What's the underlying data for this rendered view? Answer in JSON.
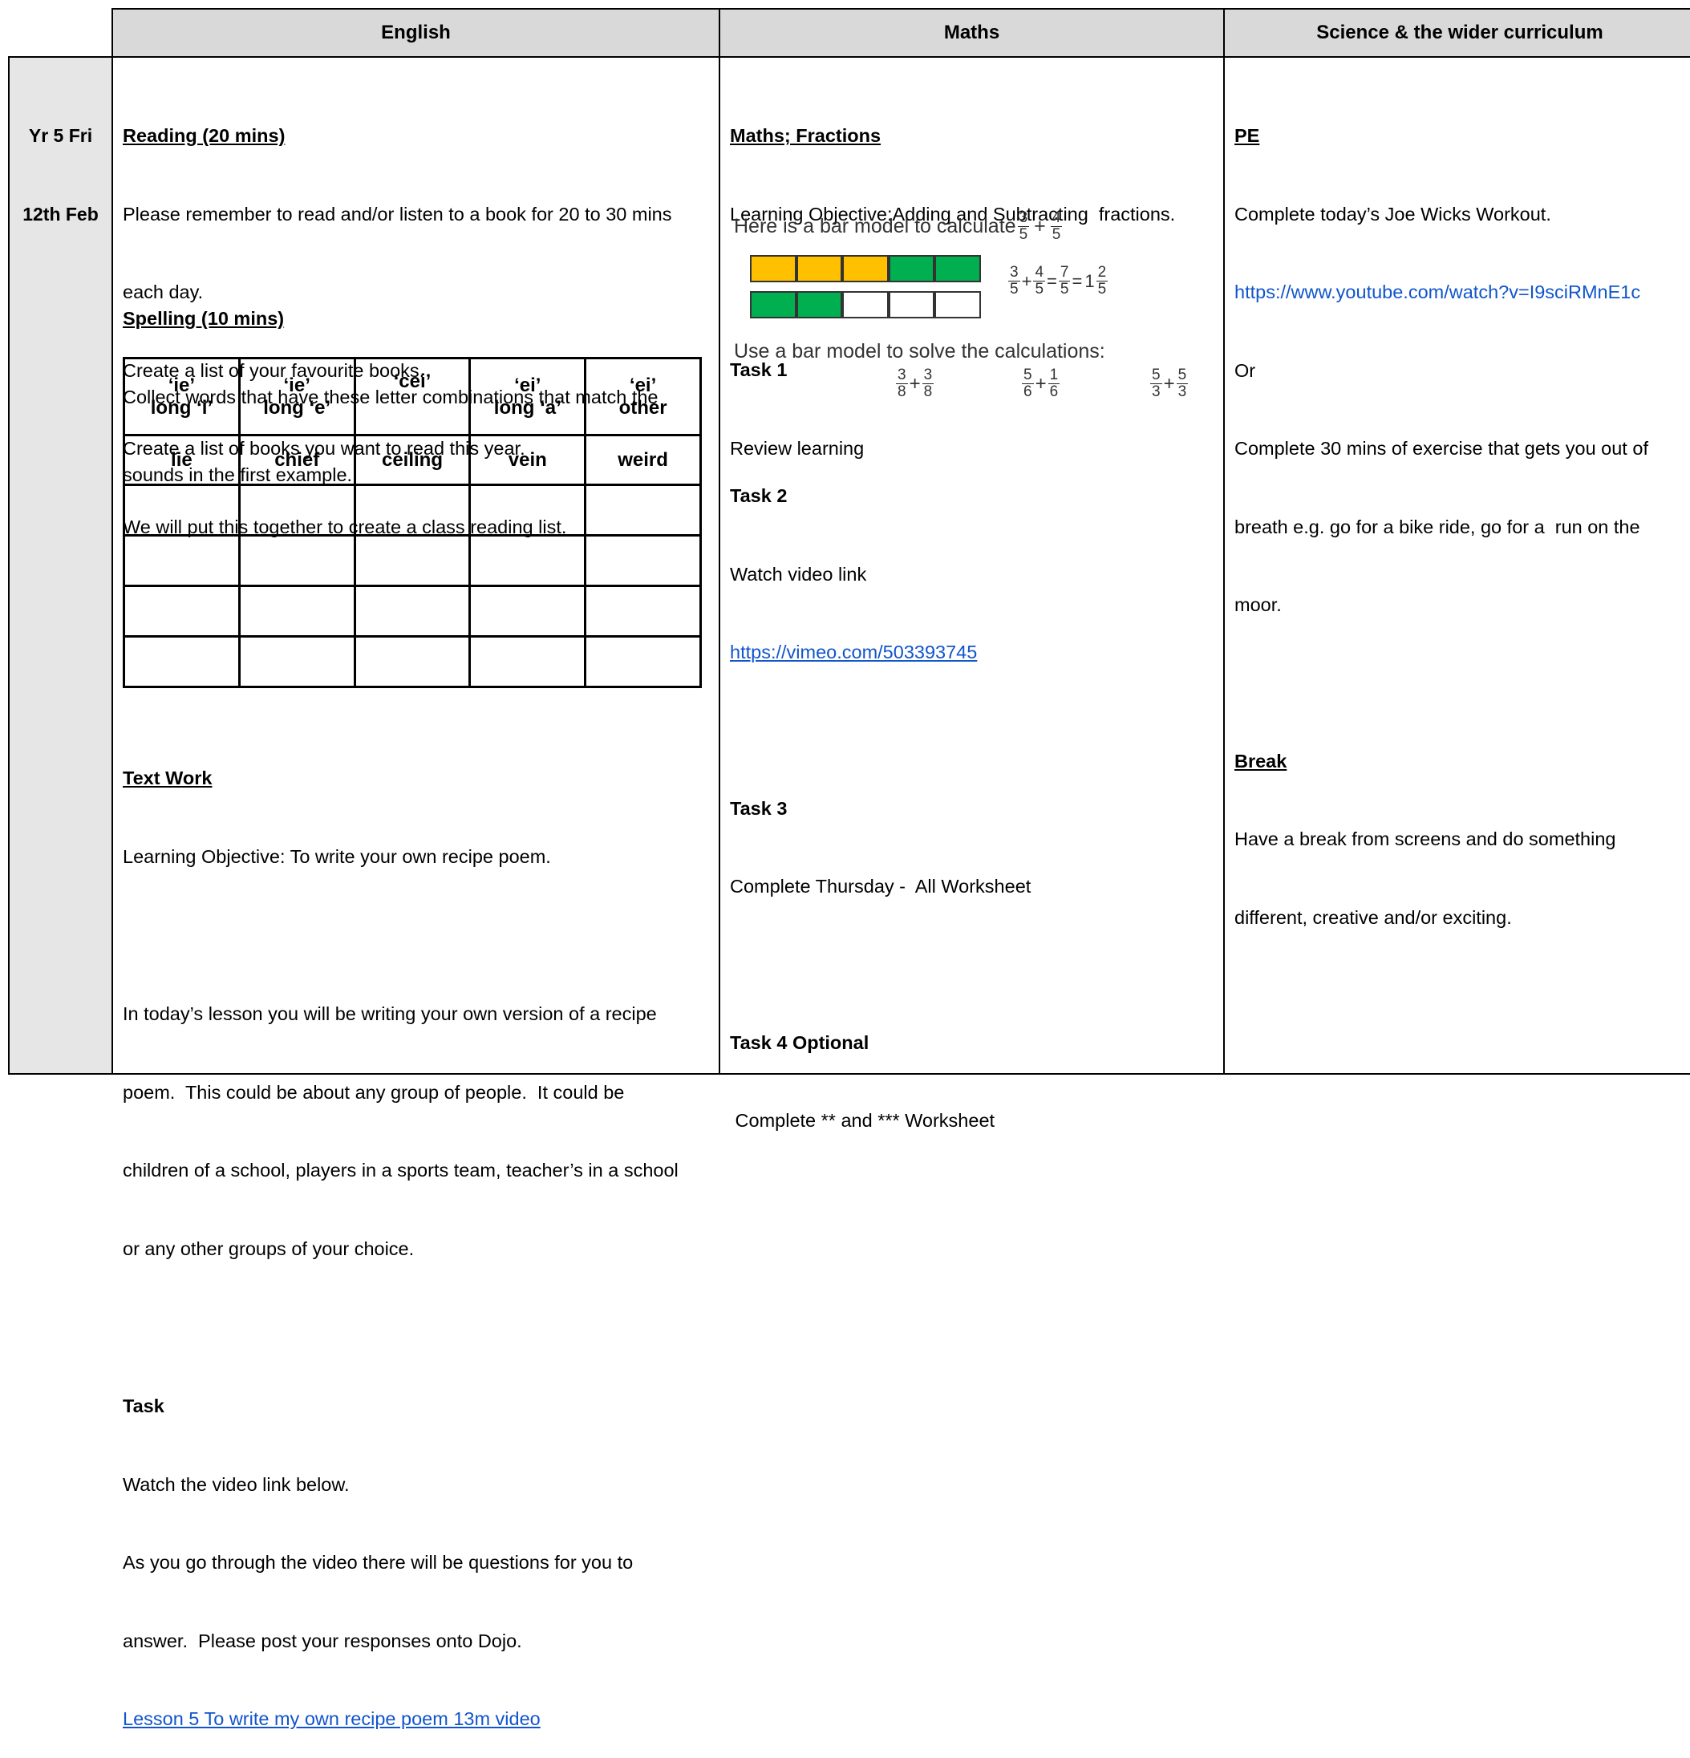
{
  "header": {
    "english": "English",
    "maths": "Maths",
    "science": "Science & the wider curriculum"
  },
  "day": {
    "line1": "Yr 5 Fri",
    "line2": "12th Feb"
  },
  "english": {
    "reading_title": "Reading (20 mins)",
    "reading_lines": [
      "Please remember to read and/or listen to a book for 20 to 30 mins",
      "each day.",
      "Create a list of your favourite books.",
      "Create a list of books you want to read this year.",
      "We will put this together to create a class reading list."
    ],
    "spelling_title": "Spelling (10 mins)",
    "spelling_lines": [
      "Collect words that have these letter combinations that match the",
      "sounds in the first example."
    ],
    "spelling_table": {
      "headers": [
        [
          "‘ie’",
          "long ‘i’"
        ],
        [
          "‘ie’",
          "long ‘e’"
        ],
        [
          "‘cei’",
          ""
        ],
        [
          "‘ei’",
          "long ‘a’"
        ],
        [
          "‘ei’",
          "other"
        ]
      ],
      "examples": [
        "lie",
        "chief",
        "ceiling",
        "vein",
        "weird"
      ]
    },
    "textwork_title": "Text Work",
    "textwork_objective": "Learning Objective: To write your own recipe poem.",
    "textwork_lines": [
      "In today’s lesson you will be writing your own version of a recipe",
      "poem.  This could be about any group of people.  It could be",
      "children of a school, players in a sports team, teacher’s in a school",
      "or any other groups of your choice."
    ],
    "task_title": "Task",
    "task_lines": [
      "Watch the video link below.",
      "As you go through the video there will be questions for you to",
      "answer.  Please post your responses onto Dojo."
    ],
    "task_link": "Lesson 5 To write my own recipe poem 13m video"
  },
  "maths": {
    "title": "Maths; Fractions",
    "objective": "Learning Objective:Adding and Subtracting  fractions.",
    "task1_title": "Task 1",
    "task1_text": "Review learning",
    "bar_model_intro": "Here is a bar model to calculate",
    "bar_model_eq": {
      "a_n": "3",
      "a_d": "5",
      "b_n": "4",
      "b_d": "5",
      "c_n": "7",
      "c_d": "5",
      "whole": "1",
      "r_n": "2",
      "r_d": "5"
    },
    "bar_model_prompt": "Use a bar model to solve the calculations:",
    "calcs": [
      {
        "a_n": "3",
        "a_d": "8",
        "b_n": "3",
        "b_d": "8"
      },
      {
        "a_n": "5",
        "a_d": "6",
        "b_n": "1",
        "b_d": "6"
      },
      {
        "a_n": "5",
        "a_d": "3",
        "b_n": "5",
        "b_d": "3"
      }
    ],
    "bar1_colors": [
      "#ffc000",
      "#ffc000",
      "#ffc000",
      "#00b050",
      "#00b050"
    ],
    "bar2_colors": [
      "#00b050",
      "#00b050",
      "#ffffff",
      "#ffffff",
      "#ffffff"
    ],
    "task2_title": "Task 2",
    "task2_text": "Watch video link",
    "task2_link": "https://vimeo.com/503393745",
    "task3_title": "Task 3",
    "task3_text": "Complete Thursday -  All Worksheet",
    "task4_title": "Task 4 Optional",
    "task4_text": " Complete ** and *** Worksheet"
  },
  "science": {
    "pe_title": "PE",
    "pe_text": "Complete today’s Joe Wicks Workout.",
    "pe_link": "https://www.youtube.com/watch?v=I9sciRMnE1c",
    "or": "Or",
    "pe_alt_lines": [
      "Complete 30 mins of exercise that gets you out of",
      "breath e.g. go for a bike ride, go for a  run on the",
      "moor."
    ],
    "break_title": "Break",
    "break_lines": [
      "Have a break from screens and do something",
      "different, creative and/or exciting."
    ]
  }
}
